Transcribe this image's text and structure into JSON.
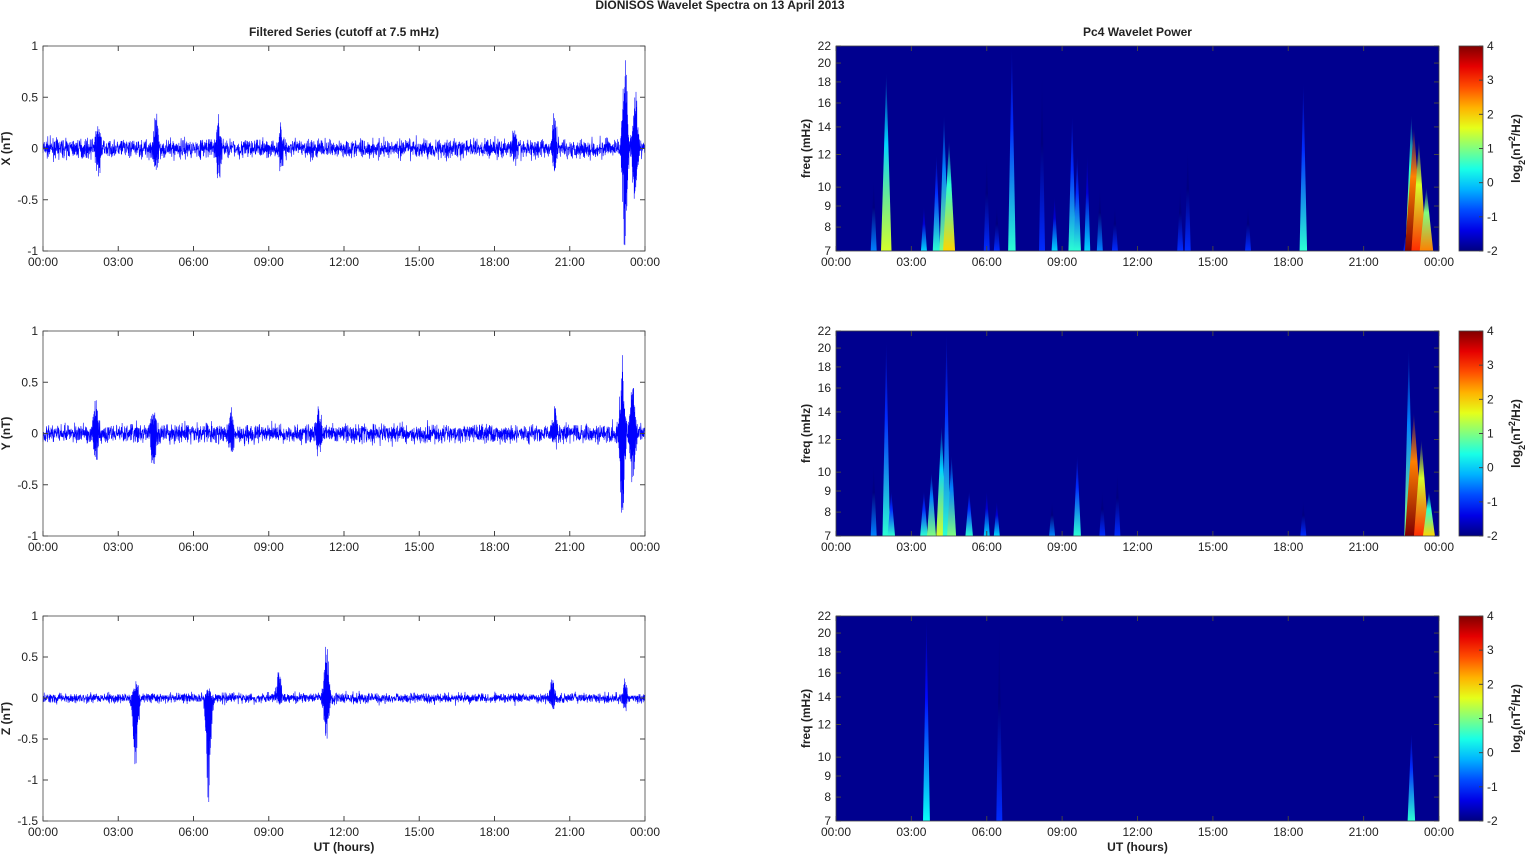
{
  "title": "DIONISOS Wavelet Spectra on 13 April     2013",
  "chart_data": [
    {
      "type": "line",
      "panel": "X",
      "title": "Filtered Series (cutoff at 7.5 mHz)",
      "xlabel": "",
      "ylabel": "X (nT)",
      "ylim": [
        -1,
        1
      ],
      "yticks": [
        "1",
        "0.5",
        "0",
        "-0.5",
        "-1"
      ],
      "ytick_values": [
        1,
        0.5,
        0,
        -0.5,
        -1
      ],
      "xticks": [
        "00:00",
        "03:00",
        "06:00",
        "09:00",
        "12:00",
        "15:00",
        "18:00",
        "21:00",
        "00:00"
      ],
      "xlim_hours": [
        0,
        24
      ],
      "color": "#0000ff",
      "noise_std": 0.045,
      "events": [
        [
          2.2,
          0.25,
          0.3
        ],
        [
          4.5,
          0.28,
          0.3
        ],
        [
          7.0,
          0.3,
          0.3
        ],
        [
          9.5,
          0.2,
          0.18
        ],
        [
          18.8,
          0.18,
          0.15
        ],
        [
          20.4,
          0.35,
          0.2
        ],
        [
          23.2,
          0.92,
          0.95
        ],
        [
          23.6,
          0.7,
          0.6
        ]
      ]
    },
    {
      "type": "line",
      "panel": "Y",
      "title": "",
      "xlabel": "",
      "ylabel": "Y (nT)",
      "ylim": [
        -1,
        1
      ],
      "yticks": [
        "1",
        "0.5",
        "0",
        "-0.5",
        "-1"
      ],
      "ytick_values": [
        1,
        0.5,
        0,
        -0.5,
        -1
      ],
      "xticks": [
        "00:00",
        "03:00",
        "06:00",
        "09:00",
        "12:00",
        "15:00",
        "18:00",
        "21:00",
        "00:00"
      ],
      "xlim_hours": [
        0,
        24
      ],
      "color": "#0000ff",
      "noise_std": 0.045,
      "events": [
        [
          2.1,
          0.38,
          0.3
        ],
        [
          4.4,
          0.3,
          0.37
        ],
        [
          7.5,
          0.2,
          0.2
        ],
        [
          11.0,
          0.25,
          0.2
        ],
        [
          20.4,
          0.25,
          0.15
        ],
        [
          23.1,
          0.75,
          0.9
        ],
        [
          23.5,
          0.5,
          0.5
        ]
      ]
    },
    {
      "type": "line",
      "panel": "Z",
      "title": "",
      "xlabel": "UT (hours)",
      "ylabel": "Z (nT)",
      "ylim": [
        -1.5,
        1
      ],
      "yticks": [
        "1",
        "0.5",
        "0",
        "-0.5",
        "-1",
        "-1.5"
      ],
      "ytick_values": [
        1,
        0.5,
        0,
        -0.5,
        -1,
        -1.5
      ],
      "xticks": [
        "00:00",
        "03:00",
        "06:00",
        "09:00",
        "12:00",
        "15:00",
        "18:00",
        "21:00",
        "00:00"
      ],
      "xlim_hours": [
        0,
        24
      ],
      "color": "#0000ff",
      "noise_std": 0.03,
      "events": [
        [
          3.7,
          0.25,
          1.05
        ],
        [
          6.6,
          0.15,
          1.37
        ],
        [
          9.4,
          0.35,
          0.05
        ],
        [
          11.3,
          0.7,
          0.55
        ],
        [
          20.3,
          0.28,
          0.15
        ],
        [
          23.2,
          0.25,
          0.2
        ]
      ]
    },
    {
      "type": "heatmap",
      "panel": "X",
      "title": "Pc4 Wavelet Power",
      "xlabel": "",
      "ylabel": "freq (mHz)",
      "ylim": [
        7,
        22
      ],
      "yscale": "log",
      "yticks": [
        "22",
        "20",
        "18",
        "16",
        "14",
        "12",
        "10",
        "9",
        "8",
        "7"
      ],
      "ytick_values": [
        22,
        20,
        18,
        16,
        14,
        12,
        10,
        9,
        8,
        7
      ],
      "xticks": [
        "00:00",
        "03:00",
        "06:00",
        "09:00",
        "12:00",
        "15:00",
        "18:00",
        "21:00",
        "00:00"
      ],
      "colorbar": {
        "label": "log2(nT²/Hz)",
        "range": [
          -2,
          4
        ],
        "ticks": [
          "4",
          "3",
          "2",
          "1",
          "0",
          "-1",
          "-2"
        ],
        "tick_values": [
          4,
          3,
          2,
          1,
          0,
          -1,
          -2
        ]
      },
      "bursts": [
        [
          1.5,
          10.5,
          -0.5
        ],
        [
          2.0,
          19,
          1.5
        ],
        [
          3.5,
          9,
          0
        ],
        [
          4.0,
          12,
          0.5
        ],
        [
          4.3,
          15,
          1
        ],
        [
          4.5,
          13,
          2
        ],
        [
          6.0,
          12,
          -1
        ],
        [
          6.4,
          9,
          -1
        ],
        [
          7.0,
          22,
          0.5
        ],
        [
          8.2,
          19,
          -1
        ],
        [
          8.7,
          9.5,
          0
        ],
        [
          9.4,
          15,
          0.5
        ],
        [
          9.6,
          12,
          0.5
        ],
        [
          10.0,
          12,
          0
        ],
        [
          10.5,
          10,
          -0.5
        ],
        [
          11.1,
          9,
          -1
        ],
        [
          13.7,
          10,
          -1
        ],
        [
          14.0,
          12.5,
          -1
        ],
        [
          16.4,
          9,
          -1
        ],
        [
          18.6,
          18,
          0.5
        ],
        [
          22.7,
          8,
          -1
        ],
        [
          22.9,
          15,
          2
        ],
        [
          23.0,
          14,
          4
        ],
        [
          23.2,
          13,
          3
        ],
        [
          23.5,
          10,
          2.5
        ]
      ]
    },
    {
      "type": "heatmap",
      "panel": "Y",
      "title": "",
      "xlabel": "",
      "ylabel": "freq (mHz)",
      "ylim": [
        7,
        22
      ],
      "yscale": "log",
      "yticks": [
        "22",
        "20",
        "18",
        "16",
        "14",
        "12",
        "10",
        "9",
        "8",
        "7"
      ],
      "ytick_values": [
        22,
        20,
        18,
        16,
        14,
        12,
        10,
        9,
        8,
        7
      ],
      "xticks": [
        "00:00",
        "03:00",
        "06:00",
        "09:00",
        "12:00",
        "15:00",
        "18:00",
        "21:00",
        "00:00"
      ],
      "colorbar": {
        "label": "log2(nT²/Hz)",
        "range": [
          -2,
          4
        ],
        "ticks": [
          "4",
          "3",
          "2",
          "1",
          "0",
          "-1",
          "-2"
        ],
        "tick_values": [
          4,
          3,
          2,
          1,
          0,
          -1,
          -2
        ]
      },
      "bursts": [
        [
          1.5,
          10.5,
          -0.5
        ],
        [
          2.0,
          21,
          0.5
        ],
        [
          2.2,
          9,
          0.5
        ],
        [
          3.5,
          9,
          0.5
        ],
        [
          3.8,
          10,
          1
        ],
        [
          4.2,
          13,
          1.5
        ],
        [
          4.4,
          22,
          0.5
        ],
        [
          4.6,
          11,
          1
        ],
        [
          5.3,
          9,
          0.5
        ],
        [
          6.0,
          9,
          0
        ],
        [
          6.4,
          8.5,
          0
        ],
        [
          8.6,
          8.5,
          -0.5
        ],
        [
          9.6,
          11,
          0.5
        ],
        [
          10.6,
          9,
          -1
        ],
        [
          11.2,
          10,
          -1
        ],
        [
          18.6,
          8.5,
          -1
        ],
        [
          22.8,
          20,
          1
        ],
        [
          23.0,
          14,
          4
        ],
        [
          23.3,
          12,
          3
        ],
        [
          23.6,
          9,
          2
        ]
      ]
    },
    {
      "type": "heatmap",
      "panel": "Z",
      "title": "",
      "xlabel": "UT (hours)",
      "ylabel": "freq (mHz)",
      "ylim": [
        7,
        22
      ],
      "yscale": "log",
      "yticks": [
        "22",
        "20",
        "18",
        "16",
        "14",
        "12",
        "10",
        "9",
        "8",
        "7"
      ],
      "ytick_values": [
        22,
        20,
        18,
        16,
        14,
        12,
        10,
        9,
        8,
        7
      ],
      "xticks": [
        "00:00",
        "03:00",
        "06:00",
        "09:00",
        "12:00",
        "15:00",
        "18:00",
        "21:00",
        "00:00"
      ],
      "colorbar": {
        "label": "log2(nT²/Hz)",
        "range": [
          -2,
          4
        ],
        "ticks": [
          "4",
          "3",
          "2",
          "1",
          "0",
          "-1",
          "-2"
        ],
        "tick_values": [
          4,
          3,
          2,
          1,
          0,
          -1,
          -2
        ]
      },
      "bursts": [
        [
          3.6,
          22,
          0.3
        ],
        [
          6.5,
          21,
          -1
        ],
        [
          22.9,
          11.5,
          0.5
        ]
      ]
    }
  ]
}
